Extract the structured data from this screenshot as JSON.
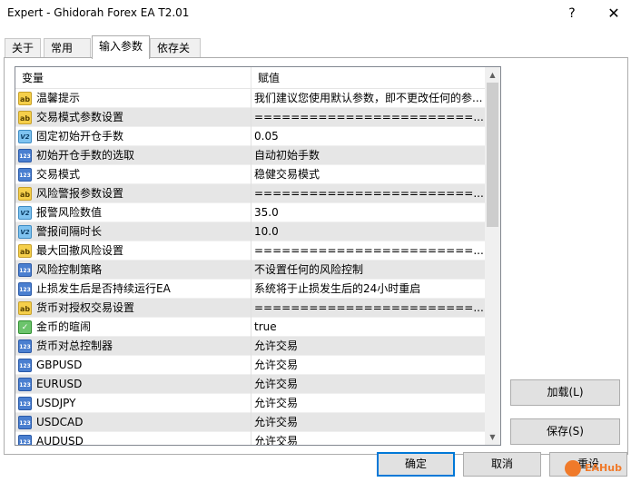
{
  "window": {
    "title": "Expert - Ghidorah Forex EA T2.01",
    "help_glyph": "?",
    "close_glyph": "✕"
  },
  "tabs": [
    {
      "label": "关于"
    },
    {
      "label": "常用"
    },
    {
      "label": "输入参数",
      "active": true
    },
    {
      "label": "依存关系"
    }
  ],
  "grid": {
    "header": {
      "variable": "变量",
      "value": "赋值"
    },
    "rows": [
      {
        "icon": "ab-string-icon",
        "name": "温馨提示",
        "value": "我们建议您使用默认参数，即不更改任何的参..."
      },
      {
        "icon": "ab-string-icon",
        "name": "交易模式参数设置",
        "value": "========================...."
      },
      {
        "icon": "v2-double-icon",
        "name": "固定初始开仓手数",
        "value": "0.05"
      },
      {
        "icon": "123-enum-icon",
        "name": "初始开仓手数的选取",
        "value": "自动初始手数"
      },
      {
        "icon": "123-enum-icon",
        "name": "交易模式",
        "value": "稳健交易模式"
      },
      {
        "icon": "ab-string-icon",
        "name": "风险警报参数设置",
        "value": "========================...."
      },
      {
        "icon": "v2-double-icon",
        "name": "报警风险数值",
        "value": "35.0"
      },
      {
        "icon": "v2-double-icon",
        "name": "警报间隔时长",
        "value": "10.0"
      },
      {
        "icon": "ab-string-icon",
        "name": "最大回撤风险设置",
        "value": "========================...."
      },
      {
        "icon": "123-enum-icon",
        "name": "风险控制策略",
        "value": "不设置任何的风险控制"
      },
      {
        "icon": "123-enum-icon",
        "name": "止损发生后是否持续运行EA",
        "value": "系统将于止损发生后的24小时重启"
      },
      {
        "icon": "ab-string-icon",
        "name": "货币对授权交易设置",
        "value": "========================...."
      },
      {
        "icon": "bool-icon",
        "name": "金币的暄闹",
        "value": "true"
      },
      {
        "icon": "123-enum-icon",
        "name": "货币对总控制器",
        "value": "允许交易"
      },
      {
        "icon": "123-enum-icon",
        "name": "GBPUSD",
        "value": "允许交易"
      },
      {
        "icon": "123-enum-icon",
        "name": "EURUSD",
        "value": "允许交易"
      },
      {
        "icon": "123-enum-icon",
        "name": "USDJPY",
        "value": "允许交易"
      },
      {
        "icon": "123-enum-icon",
        "name": "USDCAD",
        "value": "允许交易"
      },
      {
        "icon": "123-enum-icon",
        "name": "AUDUSD",
        "value": "允许交易"
      }
    ],
    "scroll": {
      "up_glyph": "▲",
      "down_glyph": "▼"
    }
  },
  "buttons": {
    "load": "加载(L)",
    "save": "保存(S)",
    "ok": "确定",
    "cancel": "取消",
    "reset": "重设"
  },
  "icon_labels": {
    "ab": "ab",
    "v2": "V2",
    "n123": "123",
    "bool": "✓"
  },
  "watermark": {
    "text": "EAHub"
  },
  "colors": {
    "accent": "#0078d7",
    "alt_row": "#e6e6e6",
    "watermark": "#f07a2a"
  }
}
